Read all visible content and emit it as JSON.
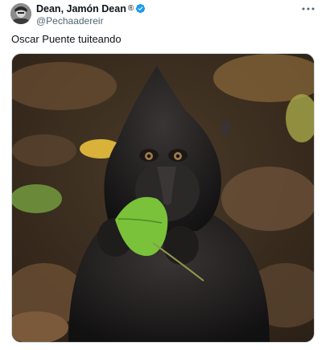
{
  "tweet": {
    "author": {
      "display_name": "Dean, Jamón Dean",
      "registered_mark": "®",
      "handle": "@Pechaadereir",
      "verified": true,
      "verified_color": "#1d9bf0"
    },
    "text": "Oscar Puente tuiteando",
    "more_icon": "more-horizontal-icon",
    "media": {
      "alt_icon": "photo-monkey-eating-leaf"
    }
  }
}
